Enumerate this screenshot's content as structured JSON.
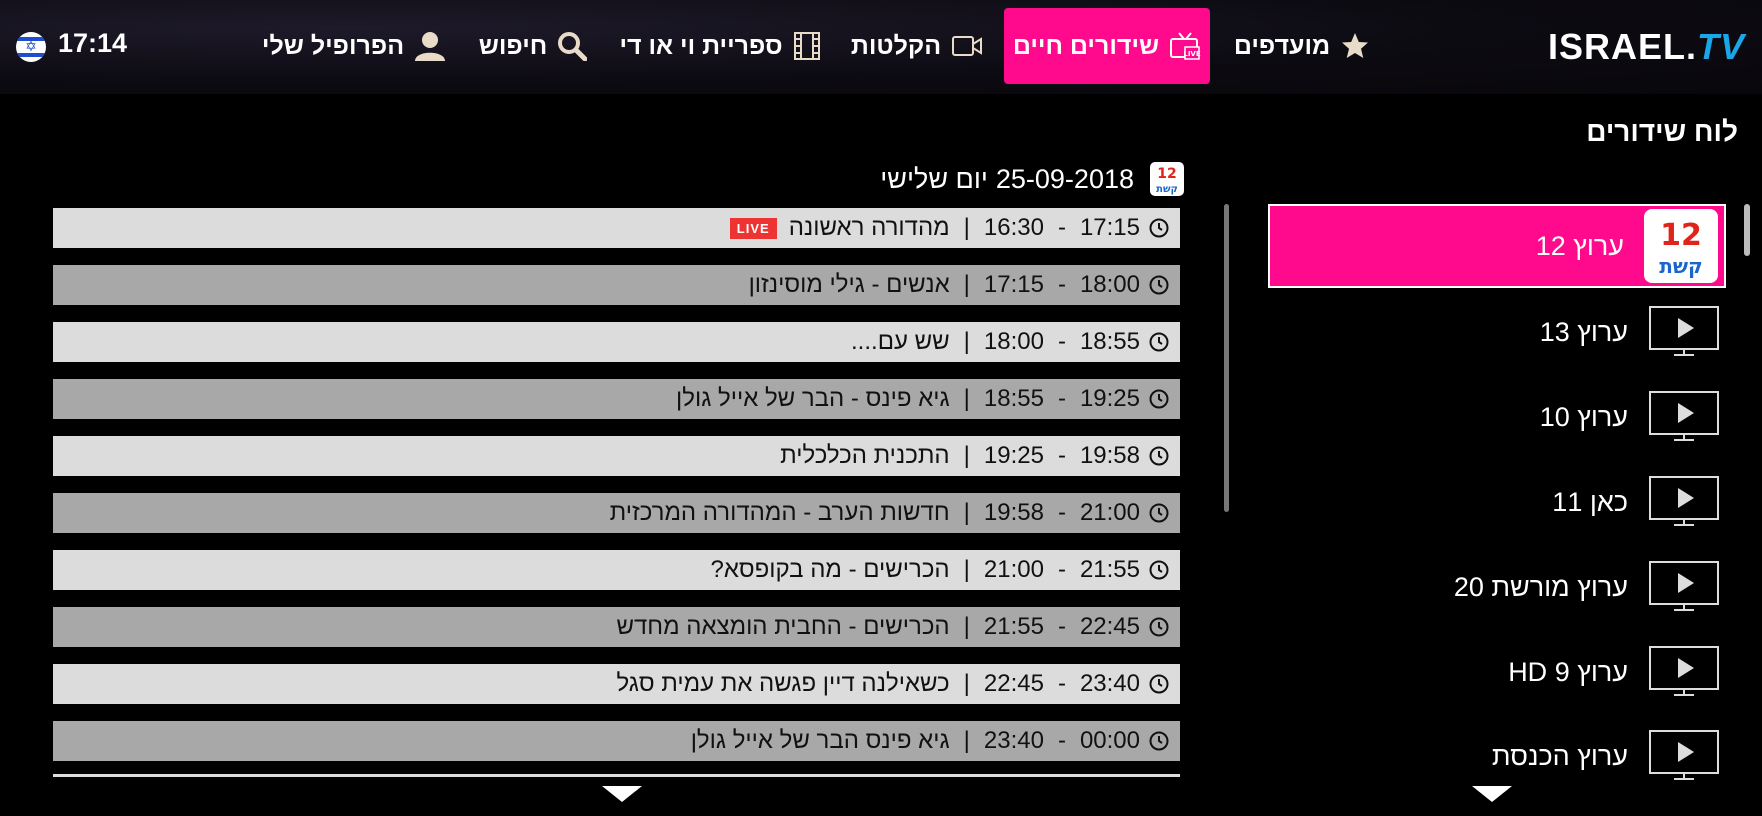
{
  "status": {
    "time": "17:14"
  },
  "nav": {
    "profile": "הפרופיל שלי",
    "search": "חיפוש",
    "vod": "ספריית וי או די",
    "recordings": "הקלטות",
    "live": "שידורים חיים",
    "favorites": "מועדפים"
  },
  "logo": {
    "text_main": "ISRAEL.",
    "text_tv": "TV"
  },
  "colors": {
    "accent": "#ff0a8c",
    "logo_blue": "#1aa7e8",
    "live_badge": "#e33333"
  },
  "sidebar": {
    "title": "לוח שידורים",
    "channels": [
      {
        "name": "ערוץ 12",
        "active": true,
        "icon": "keshet-12-logo"
      },
      {
        "name": "ערוץ 13",
        "active": false,
        "icon": "tv-play-icon"
      },
      {
        "name": "ערוץ 10",
        "active": false,
        "icon": "tv-play-icon"
      },
      {
        "name": "כאן 11",
        "active": false,
        "icon": "tv-play-icon"
      },
      {
        "name": "ערוץ מורשת 20",
        "active": false,
        "icon": "tv-play-icon"
      },
      {
        "name": "ערוץ 9 HD",
        "active": false,
        "icon": "tv-play-icon"
      },
      {
        "name": "ערוץ הכנסת",
        "active": false,
        "icon": "tv-play-icon"
      }
    ],
    "channel_logo": {
      "number": "12",
      "brand": "קשת"
    }
  },
  "schedule": {
    "date": "25-09-2018",
    "day": "יום שלישי",
    "live_label": "LIVE",
    "programs": [
      {
        "start": "16:30",
        "end": "17:15",
        "title": "מהדורה ראשונה",
        "live": true
      },
      {
        "start": "17:15",
        "end": "18:00",
        "title": "אנשים - גילי מוסינזון",
        "live": false
      },
      {
        "start": "18:00",
        "end": "18:55",
        "title": "שש עם....",
        "live": false
      },
      {
        "start": "18:55",
        "end": "19:25",
        "title": "גיא פינס - הבר של אייל גולן",
        "live": false
      },
      {
        "start": "19:25",
        "end": "19:58",
        "title": "התכנית הכלכלית",
        "live": false
      },
      {
        "start": "19:58",
        "end": "21:00",
        "title": "חדשות הערב - המהדורה המרכזית",
        "live": false
      },
      {
        "start": "21:00",
        "end": "21:55",
        "title": "הכרישים - מה בקופסא?",
        "live": false
      },
      {
        "start": "21:55",
        "end": "22:45",
        "title": "הכרישים - החבית הומצאה מחדש",
        "live": false
      },
      {
        "start": "22:45",
        "end": "23:40",
        "title": "כשאילנה דיין פגשה את עמית סגל",
        "live": false
      },
      {
        "start": "23:40",
        "end": "00:00",
        "title": "גיא פינס הבר של אייל גולן",
        "live": false
      }
    ]
  }
}
